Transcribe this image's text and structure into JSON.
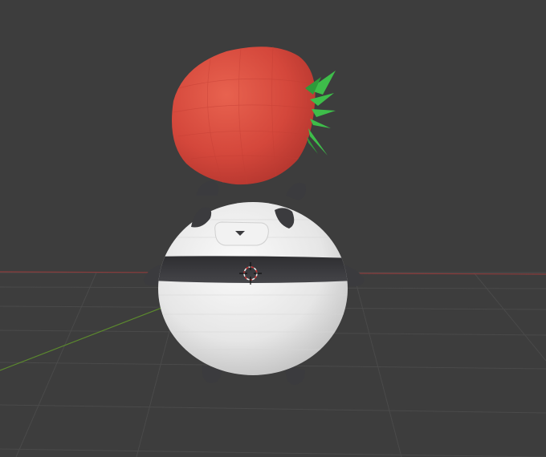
{
  "viewport": {
    "background": "#3d3d3d",
    "grid_color": "#4a4a4a",
    "x_axis_color": "#8a3b3b",
    "y_axis_color": "#5c8a2e"
  },
  "scene": {
    "objects": [
      "panda-character",
      "strawberry"
    ],
    "colors": {
      "panda_body": "#e9e9e9",
      "panda_dark": "#3b3b3e",
      "strawberry_red": "#d5473c",
      "strawberry_leaf": "#3ebd4a"
    }
  },
  "cursor": {
    "icon": "3d-cursor-icon"
  }
}
